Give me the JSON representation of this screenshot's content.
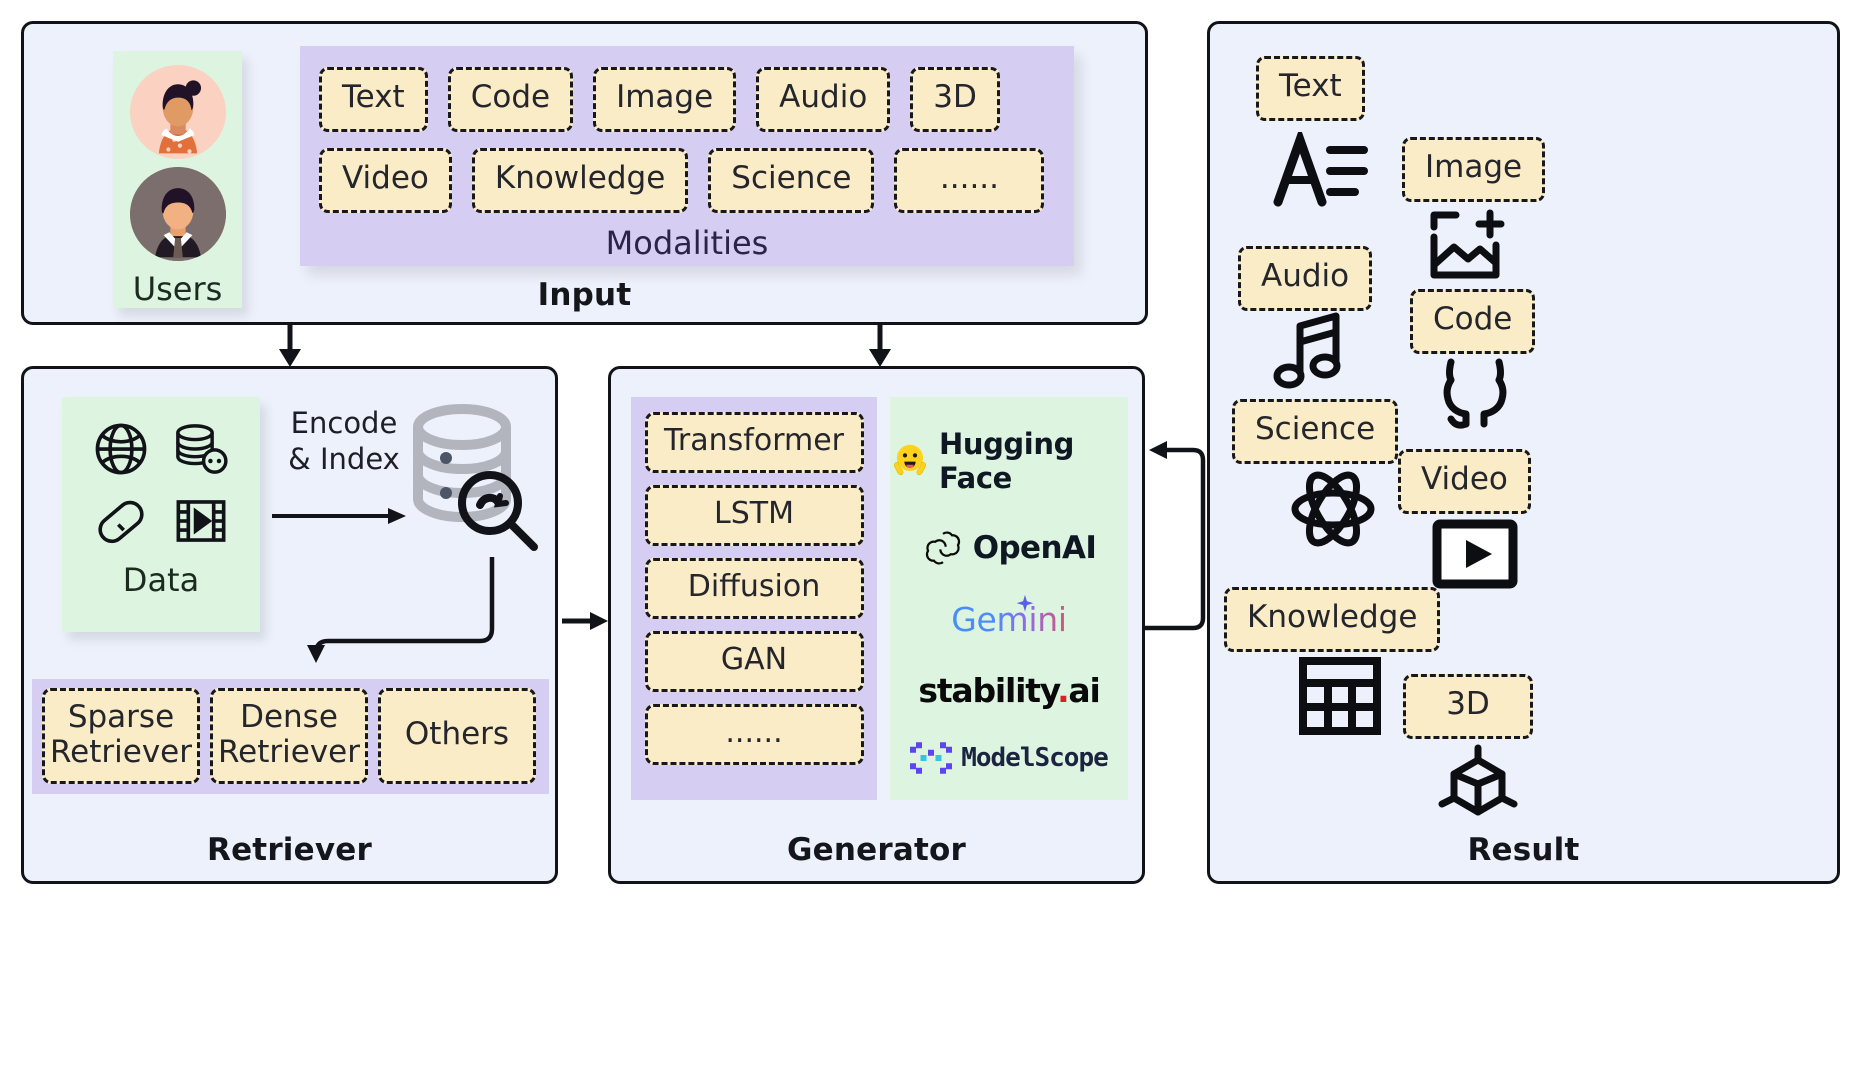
{
  "diagram": {
    "title_input": "Input",
    "title_retriever": "Retriever",
    "title_generator": "Generator",
    "title_result": "Result"
  },
  "input": {
    "users_label": "Users",
    "avatars": [
      "user-avatar-female",
      "user-avatar-male"
    ],
    "modalities_caption": "Modalities",
    "modalities_row1": [
      "Text",
      "Code",
      "Image",
      "Audio",
      "3D"
    ],
    "modalities_row2": [
      "Video",
      "Knowledge",
      "Science",
      "......"
    ]
  },
  "retriever": {
    "data_label": "Data",
    "data_icons": [
      "globe-icon",
      "database-icon",
      "capsule-icon",
      "film-icon"
    ],
    "encode_label_line1": "Encode",
    "encode_label_line2": "& Index",
    "index_icon": "database-search-icon",
    "retrievers": [
      {
        "line1": "Sparse",
        "line2": "Retriever"
      },
      {
        "line1": "Dense",
        "line2": "Retriever"
      },
      {
        "line1": "Others",
        "line2": ""
      }
    ]
  },
  "generator": {
    "models": [
      "Transformer",
      "LSTM",
      "Diffusion",
      "GAN",
      "......"
    ],
    "brands": [
      {
        "name": "Hugging Face",
        "icon": "hugging-face-icon"
      },
      {
        "name": "OpenAI",
        "icon": "openai-icon"
      },
      {
        "name": "Gemini",
        "icon": "gemini-sparkle-icon"
      },
      {
        "name": "stability.ai",
        "icon": "none"
      },
      {
        "name": "ModelScope",
        "icon": "modelscope-icon"
      }
    ]
  },
  "result": {
    "items": [
      {
        "label": "Text",
        "icon": "text-format-icon"
      },
      {
        "label": "Image",
        "icon": "add-image-icon"
      },
      {
        "label": "Audio",
        "icon": "music-note-icon"
      },
      {
        "label": "Code",
        "icon": "github-cat-icon"
      },
      {
        "label": "Science",
        "icon": "atom-icon"
      },
      {
        "label": "Video",
        "icon": "play-video-icon"
      },
      {
        "label": "Knowledge",
        "icon": "table-grid-icon"
      },
      {
        "label": "3D",
        "icon": "cube-icon"
      }
    ]
  },
  "colors": {
    "panel_bg": "#edf1fb",
    "panel_border": "#111318",
    "chip_bg": "#fbecc8",
    "chip_border": "#16181d",
    "purple_group": "#d6cdf2",
    "green_group": "#ddf5e0"
  }
}
